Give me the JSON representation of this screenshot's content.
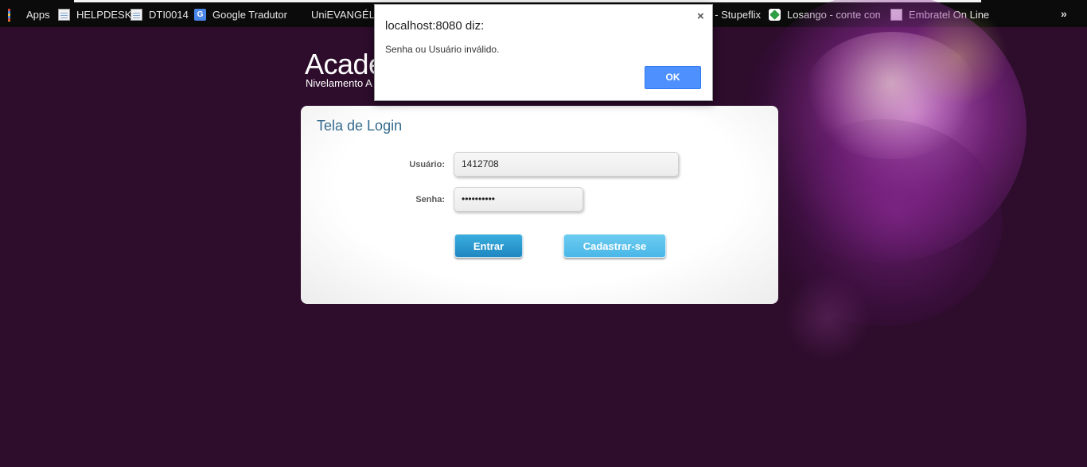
{
  "bookmarks_bar": {
    "items": [
      {
        "label": "Apps",
        "icon": "apps-grid-icon"
      },
      {
        "label": "HELPDESK",
        "icon": "page-icon"
      },
      {
        "label": "DTI0014",
        "icon": "page-icon"
      },
      {
        "label": "Google Tradutor",
        "icon": "google-translate-icon"
      },
      {
        "label": "UniEVANGÉLICA",
        "icon": "univ-logo-icon"
      },
      {
        "label": "s - Stupeflix",
        "icon": ""
      },
      {
        "label": "Losango - conte com",
        "icon": "losango-icon"
      },
      {
        "label": "Embratel On Line",
        "icon": "page-icon"
      }
    ],
    "more_label": "»"
  },
  "brand": {
    "title": "Acade",
    "subtitle": "Nivelamento A"
  },
  "login": {
    "title": "Tela de Login",
    "user_label": "Usuário:",
    "user_value": "1412708",
    "password_label": "Senha:",
    "password_value": "••••••••••",
    "enter_button": "Entrar",
    "register_button": "Cadastrar-se"
  },
  "alert": {
    "title": "localhost:8080 diz:",
    "message": "Senha ou Usuário inválido.",
    "ok_label": "OK",
    "close_label": "×",
    "accent_color": "#4d90fe"
  },
  "colors": {
    "page_background": "#2d0c2c",
    "panel_title": "#336a8e",
    "primary_button": "#1f87c0"
  }
}
